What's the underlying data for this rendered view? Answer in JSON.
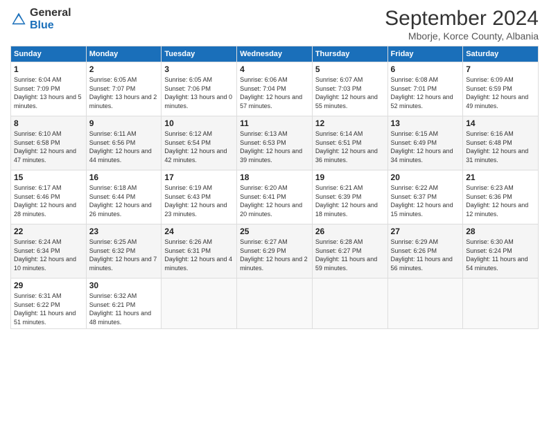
{
  "header": {
    "logo_general": "General",
    "logo_blue": "Blue",
    "title": "September 2024",
    "location": "Mborje, Korce County, Albania"
  },
  "days_of_week": [
    "Sunday",
    "Monday",
    "Tuesday",
    "Wednesday",
    "Thursday",
    "Friday",
    "Saturday"
  ],
  "weeks": [
    [
      {
        "day": "1",
        "sunrise": "6:04 AM",
        "sunset": "7:09 PM",
        "daylight": "13 hours and 5 minutes."
      },
      {
        "day": "2",
        "sunrise": "6:05 AM",
        "sunset": "7:07 PM",
        "daylight": "13 hours and 2 minutes."
      },
      {
        "day": "3",
        "sunrise": "6:05 AM",
        "sunset": "7:06 PM",
        "daylight": "13 hours and 0 minutes."
      },
      {
        "day": "4",
        "sunrise": "6:06 AM",
        "sunset": "7:04 PM",
        "daylight": "12 hours and 57 minutes."
      },
      {
        "day": "5",
        "sunrise": "6:07 AM",
        "sunset": "7:03 PM",
        "daylight": "12 hours and 55 minutes."
      },
      {
        "day": "6",
        "sunrise": "6:08 AM",
        "sunset": "7:01 PM",
        "daylight": "12 hours and 52 minutes."
      },
      {
        "day": "7",
        "sunrise": "6:09 AM",
        "sunset": "6:59 PM",
        "daylight": "12 hours and 49 minutes."
      }
    ],
    [
      {
        "day": "8",
        "sunrise": "6:10 AM",
        "sunset": "6:58 PM",
        "daylight": "12 hours and 47 minutes."
      },
      {
        "day": "9",
        "sunrise": "6:11 AM",
        "sunset": "6:56 PM",
        "daylight": "12 hours and 44 minutes."
      },
      {
        "day": "10",
        "sunrise": "6:12 AM",
        "sunset": "6:54 PM",
        "daylight": "12 hours and 42 minutes."
      },
      {
        "day": "11",
        "sunrise": "6:13 AM",
        "sunset": "6:53 PM",
        "daylight": "12 hours and 39 minutes."
      },
      {
        "day": "12",
        "sunrise": "6:14 AM",
        "sunset": "6:51 PM",
        "daylight": "12 hours and 36 minutes."
      },
      {
        "day": "13",
        "sunrise": "6:15 AM",
        "sunset": "6:49 PM",
        "daylight": "12 hours and 34 minutes."
      },
      {
        "day": "14",
        "sunrise": "6:16 AM",
        "sunset": "6:48 PM",
        "daylight": "12 hours and 31 minutes."
      }
    ],
    [
      {
        "day": "15",
        "sunrise": "6:17 AM",
        "sunset": "6:46 PM",
        "daylight": "12 hours and 28 minutes."
      },
      {
        "day": "16",
        "sunrise": "6:18 AM",
        "sunset": "6:44 PM",
        "daylight": "12 hours and 26 minutes."
      },
      {
        "day": "17",
        "sunrise": "6:19 AM",
        "sunset": "6:43 PM",
        "daylight": "12 hours and 23 minutes."
      },
      {
        "day": "18",
        "sunrise": "6:20 AM",
        "sunset": "6:41 PM",
        "daylight": "12 hours and 20 minutes."
      },
      {
        "day": "19",
        "sunrise": "6:21 AM",
        "sunset": "6:39 PM",
        "daylight": "12 hours and 18 minutes."
      },
      {
        "day": "20",
        "sunrise": "6:22 AM",
        "sunset": "6:37 PM",
        "daylight": "12 hours and 15 minutes."
      },
      {
        "day": "21",
        "sunrise": "6:23 AM",
        "sunset": "6:36 PM",
        "daylight": "12 hours and 12 minutes."
      }
    ],
    [
      {
        "day": "22",
        "sunrise": "6:24 AM",
        "sunset": "6:34 PM",
        "daylight": "12 hours and 10 minutes."
      },
      {
        "day": "23",
        "sunrise": "6:25 AM",
        "sunset": "6:32 PM",
        "daylight": "12 hours and 7 minutes."
      },
      {
        "day": "24",
        "sunrise": "6:26 AM",
        "sunset": "6:31 PM",
        "daylight": "12 hours and 4 minutes."
      },
      {
        "day": "25",
        "sunrise": "6:27 AM",
        "sunset": "6:29 PM",
        "daylight": "12 hours and 2 minutes."
      },
      {
        "day": "26",
        "sunrise": "6:28 AM",
        "sunset": "6:27 PM",
        "daylight": "11 hours and 59 minutes."
      },
      {
        "day": "27",
        "sunrise": "6:29 AM",
        "sunset": "6:26 PM",
        "daylight": "11 hours and 56 minutes."
      },
      {
        "day": "28",
        "sunrise": "6:30 AM",
        "sunset": "6:24 PM",
        "daylight": "11 hours and 54 minutes."
      }
    ],
    [
      {
        "day": "29",
        "sunrise": "6:31 AM",
        "sunset": "6:22 PM",
        "daylight": "11 hours and 51 minutes."
      },
      {
        "day": "30",
        "sunrise": "6:32 AM",
        "sunset": "6:21 PM",
        "daylight": "11 hours and 48 minutes."
      },
      null,
      null,
      null,
      null,
      null
    ]
  ]
}
